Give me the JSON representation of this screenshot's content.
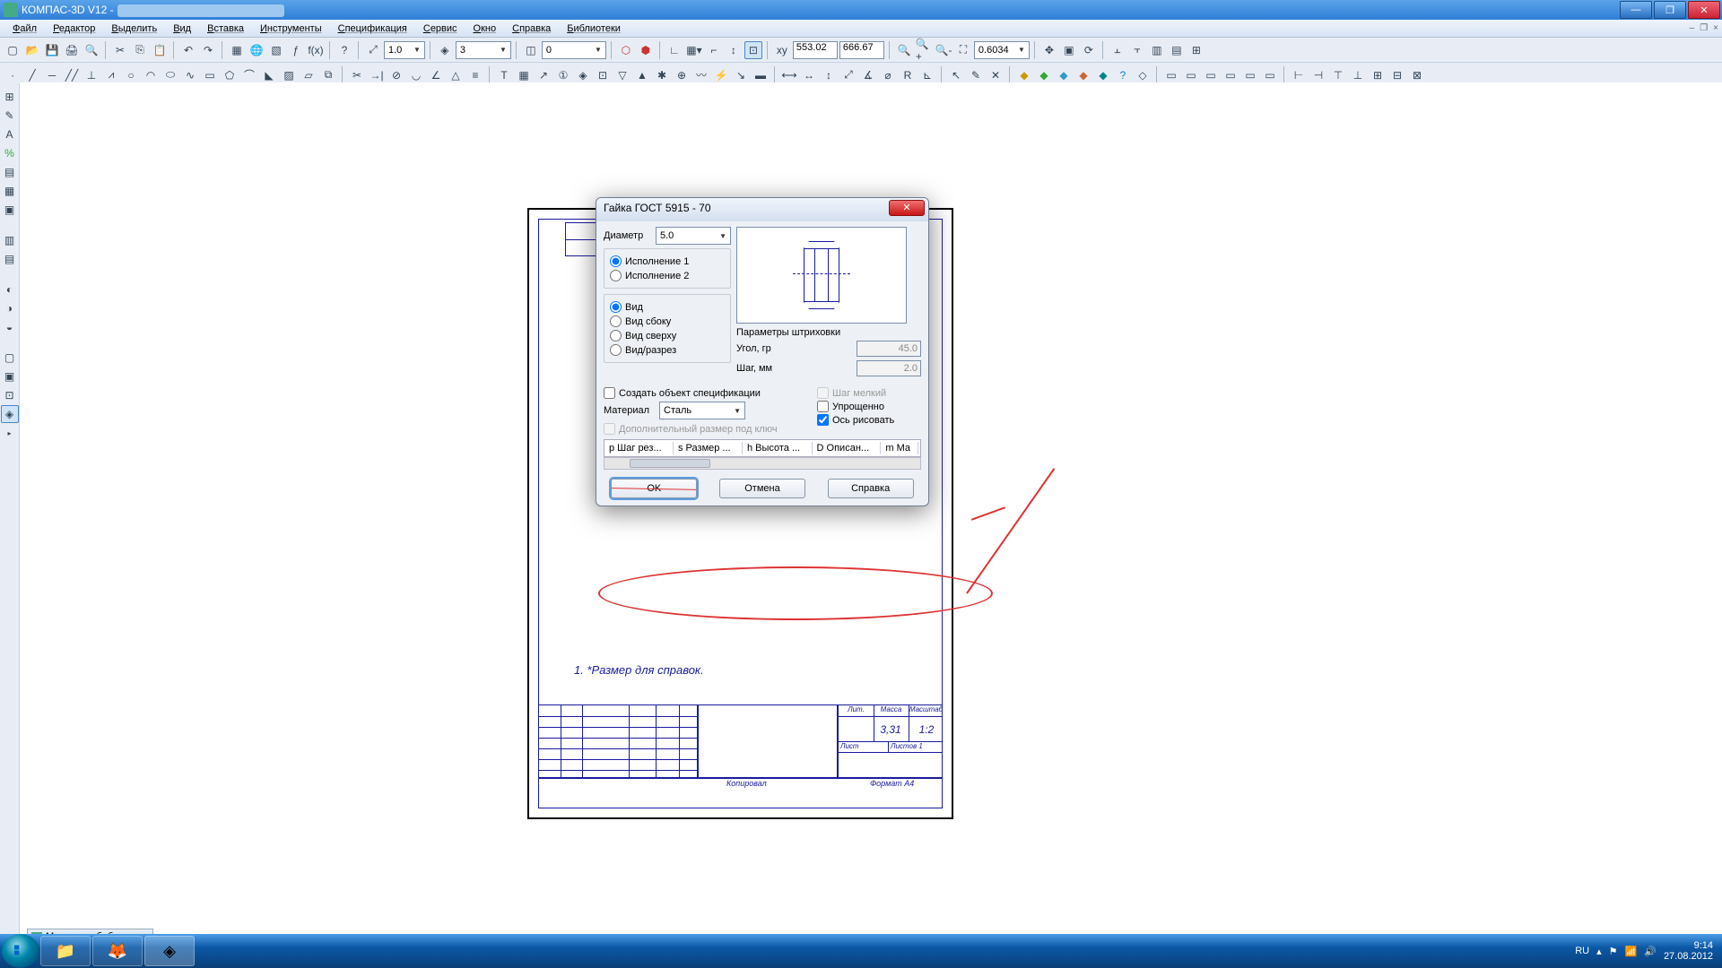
{
  "title_bar": {
    "app": "КОМПАС-3D V12 -",
    "doc": " "
  },
  "win_btns": {
    "min": "—",
    "max": "❐",
    "close": "✕"
  },
  "menu": [
    "Файл",
    "Редактор",
    "Выделить",
    "Вид",
    "Вставка",
    "Инструменты",
    "Спецификация",
    "Сервис",
    "Окно",
    "Справка",
    "Библиотеки"
  ],
  "mdi": {
    "min": "–",
    "max": "❐",
    "close": "×"
  },
  "toolbar1": {
    "scale_value": "1.0",
    "state_value": "3",
    "layer_value": "0",
    "coord_x": "553.02",
    "coord_y": "666.67",
    "zoom_value": "0.6034"
  },
  "lib_mgr": "Менеджер библиотек",
  "drawing": {
    "note": "1.  *Размер для справок.",
    "stamp_lit": "Лит.",
    "stamp_mass": "Масса",
    "stamp_scale": "Масштаб",
    "stamp_mass_v": "3,31",
    "stamp_scale_v": "1:2",
    "stamp_sheet": "Лист",
    "stamp_sheets": "Листов    1",
    "stamp_kop": "Копировал",
    "stamp_fmt": "Формат    А4"
  },
  "dialog": {
    "title": "Гайка ГОСТ 5915 - 70",
    "diameter_label": "Диаметр",
    "diameter_value": "5.0",
    "exec1": "Исполнение 1",
    "exec2": "Исполнение 2",
    "view": "Вид",
    "view_side": "Вид сбоку",
    "view_top": "Вид сверху",
    "view_section": "Вид/разрез",
    "hatch_title": "Параметры штриховки",
    "angle_label": "Угол, гр",
    "angle_value": "45.0",
    "step_label": "Шаг, мм",
    "step_value": "2.0",
    "spec_label": "Создать объект спецификации",
    "material_label": "Материал",
    "material_value": "Сталь",
    "extra_label": "Дополнительный размер под ключ",
    "step_sm": "Шаг мелкий",
    "simpl": "Упрощенно",
    "axis": "Ось рисовать",
    "cols": {
      "p": "p Шаг рез...",
      "s": "s Размер ...",
      "h": "h Высота ...",
      "d": "D Описан...",
      "m": "m Ма"
    },
    "btn_ok": "OK",
    "btn_cancel": "Отмена",
    "btn_help": "Справка"
  },
  "taskbar": {
    "lang": "RU",
    "time": "9:14",
    "date": "27.08.2012"
  }
}
